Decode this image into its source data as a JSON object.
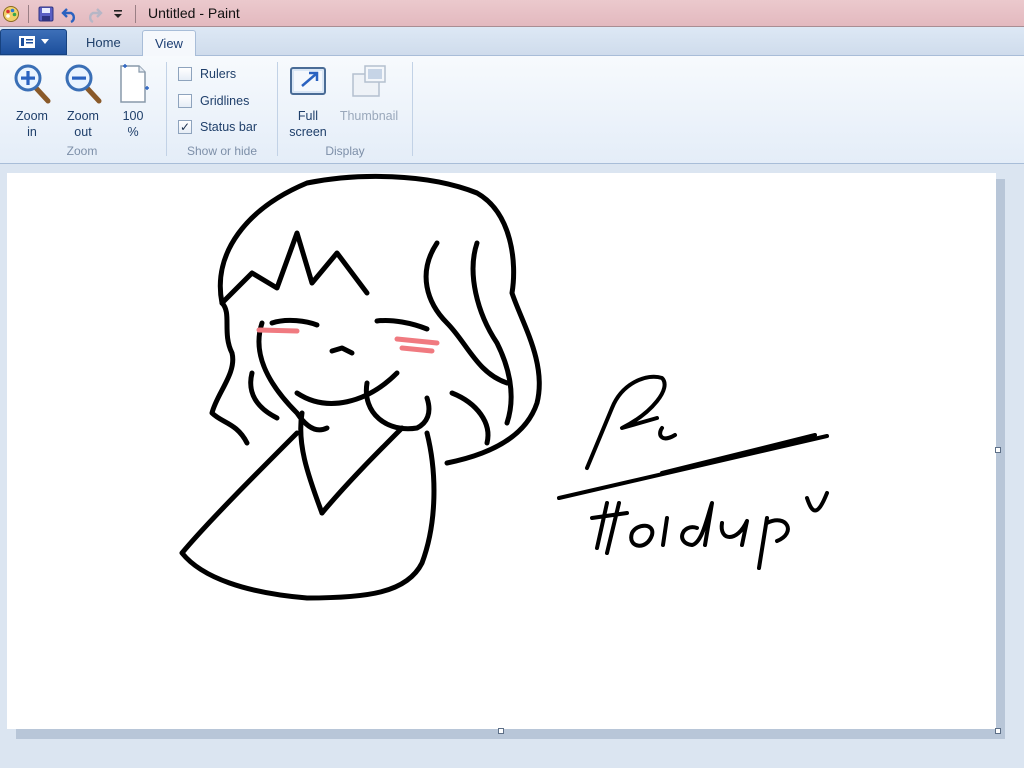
{
  "window": {
    "title": "Untitled - Paint"
  },
  "quick_access": {
    "icons": [
      "paint-app-icon",
      "save-icon",
      "undo-icon",
      "redo-icon",
      "customize-dropdown-icon"
    ]
  },
  "tabs": [
    {
      "label": "Home",
      "active": false
    },
    {
      "label": "View",
      "active": true
    }
  ],
  "ribbon": {
    "zoom_group": {
      "label": "Zoom",
      "zoom_in": {
        "line1": "Zoom",
        "line2": "in"
      },
      "zoom_out": {
        "line1": "Zoom",
        "line2": "out"
      },
      "zoom_100": {
        "line1": "100",
        "line2": "%"
      }
    },
    "show_hide_group": {
      "label": "Show or hide",
      "rulers": {
        "label": "Rulers",
        "checked": false
      },
      "gridlines": {
        "label": "Gridlines",
        "checked": false
      },
      "status_bar": {
        "label": "Status bar",
        "checked": true,
        "mark": "✓"
      }
    },
    "display_group": {
      "label": "Display",
      "full_screen": {
        "line1": "Full",
        "line2": "screen"
      },
      "thumbnail": {
        "line1": "Thumbnail",
        "enabled": false
      }
    }
  },
  "colors": {
    "titlebar": "#e3b9bf",
    "app_menu": "#1c4f9c",
    "ribbon": "#e4edf8",
    "workspace": "#dbe5f1",
    "ink": "#000000",
    "blush": "#f07a80"
  },
  "canvas": {
    "drawing": "character-sketch-with-signature"
  }
}
